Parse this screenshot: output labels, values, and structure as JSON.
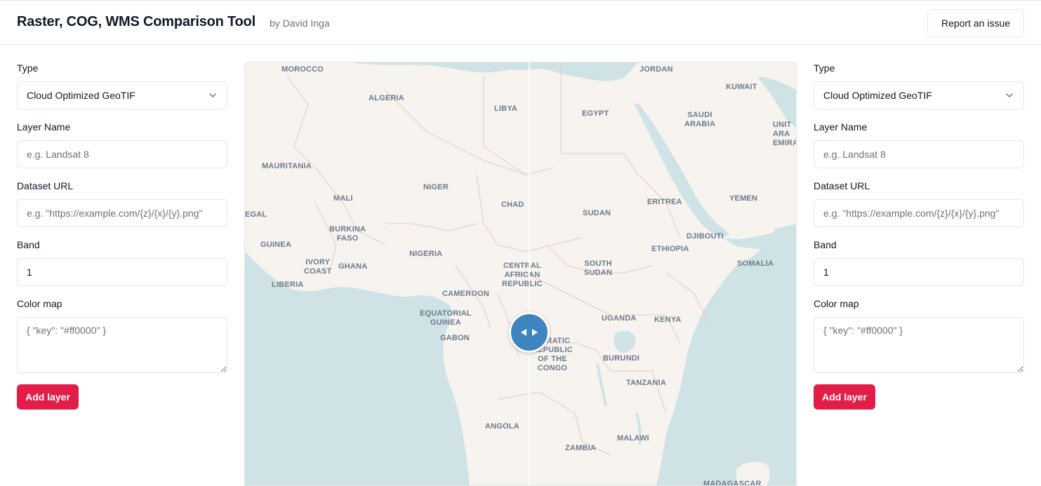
{
  "header": {
    "title": "Raster, COG, WMS Comparison Tool",
    "author": "by David Inga",
    "report_button": "Report an issue"
  },
  "left_panel": {
    "type_label": "Type",
    "type_value": "Cloud Optimized GeoTIF",
    "layer_name_label": "Layer Name",
    "layer_name_placeholder": "e.g. Landsat 8",
    "dataset_url_label": "Dataset URL",
    "dataset_url_placeholder": "e.g. \"https://example.com/{z}/{x}/{y}.png\"",
    "band_label": "Band",
    "band_value": "1",
    "color_map_label": "Color map",
    "color_map_placeholder": "{ \"key\": \"#ff0000\" }",
    "add_button": "Add layer"
  },
  "right_panel": {
    "type_label": "Type",
    "type_value": "Cloud Optimized GeoTIF",
    "layer_name_label": "Layer Name",
    "layer_name_placeholder": "e.g. Landsat 8",
    "dataset_url_label": "Dataset URL",
    "dataset_url_placeholder": "e.g. \"https://example.com/{z}/{x}/{y}.png\"",
    "band_label": "Band",
    "band_value": "1",
    "color_map_label": "Color map",
    "color_map_placeholder": "{ \"key\": \"#ff0000\" }",
    "add_button": "Add layer"
  },
  "map": {
    "labels": {
      "morocco": "MOROCCO",
      "algeria": "ALGERIA",
      "libya": "LIBYA",
      "egypt": "EGYPT",
      "jordan": "JORDAN",
      "kuwait": "KUWAIT",
      "saudi_arabia": "SAUDI\nARABIA",
      "uae": "UNIT\nARA\nEMIRA",
      "mauritania": "MAURITANIA",
      "mali": "MALI",
      "niger": "NIGER",
      "chad": "CHAD",
      "sudan": "SUDAN",
      "eritrea": "ERITREA",
      "yemen": "YEMEN",
      "senegal": "EGAL",
      "burkina_faso": "BURKINA\nFASO",
      "guinea": "GUINEA",
      "nigeria": "NIGERIA",
      "djibouti": "DJIBOUTI",
      "ethiopia": "ETHIOPIA",
      "ivory_coast": "IVORY\nCOAST",
      "ghana": "GHANA",
      "liberia": "LIBERIA",
      "car": "CENTRAL\nAFRICAN\nREPUBLIC",
      "south_sudan": "SOUTH\nSUDAN",
      "somalia": "SOMALIA",
      "cameroon": "CAMEROON",
      "equatorial_guinea": "EQUATORIAL\nGUINEA",
      "gabon": "GABON",
      "uganda": "UGANDA",
      "kenya": "KENYA",
      "drc": "OCRATIC\nREPUBLIC\nOF THE\nCONGO",
      "burundi": "BURUNDI",
      "tanzania": "TANZANIA",
      "angola": "ANGOLA",
      "zambia": "ZAMBIA",
      "malawi": "MALAWI",
      "madagascar": "MADAGASCAR"
    },
    "colors": {
      "water": "#cfe3e6",
      "land": "#f7f3ef",
      "border": "#e7c7c7",
      "swipe_handle": "#3f85bf"
    }
  },
  "colors": {
    "accent": "#e11d48",
    "border": "#e5e7eb",
    "muted_text": "#6b7280"
  }
}
